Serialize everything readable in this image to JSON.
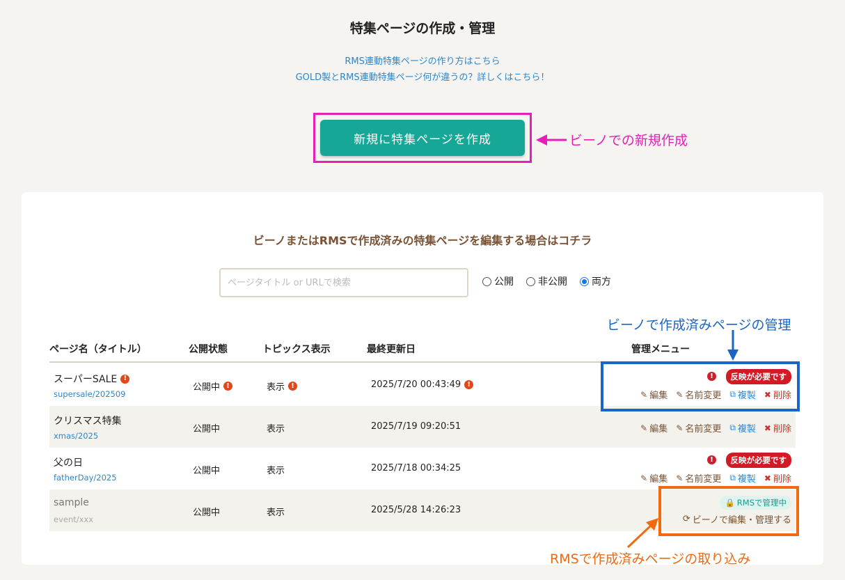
{
  "page": {
    "title": "特集ページの作成・管理",
    "help_link_1": "RMS連動特集ページの作り方はこちら",
    "help_link_2": "GOLD製とRMS連動特集ページ何が違うの？詳しくはこちら！",
    "create_button": "新規に特集ページを作成"
  },
  "annotations": {
    "create": "ビーノでの新規作成",
    "manage": "ビーノで作成済みページの管理",
    "import": "RMSで作成済みページの取り込み",
    "colors": {
      "create": "#e620b7",
      "manage": "#1a66c2",
      "import": "#f06a12"
    }
  },
  "section": {
    "title": "ビーノまたはRMSで作成済みの特集ページを編集する場合はコチラ",
    "search_placeholder": "ページタイトル or URLで検索",
    "filters": [
      {
        "label": "公開",
        "checked": false
      },
      {
        "label": "非公開",
        "checked": false
      },
      {
        "label": "両方",
        "checked": true
      }
    ]
  },
  "table": {
    "headers": {
      "name": "ページ名（タイトル）",
      "status": "公開状態",
      "topic": "トピックス表示",
      "updated": "最終更新日",
      "menu": "管理メニュー"
    },
    "actions": {
      "edit": "編集",
      "rename": "名前変更",
      "copy": "複製",
      "delete": "削除"
    },
    "need_reflect": "反映が必要です",
    "rms_managed": "RMSで管理中",
    "import_label": "ビーノで編集・管理する",
    "rows": [
      {
        "name": "スーパーSALE",
        "slug": "supersale/202509",
        "status": "公開中",
        "topic": "表示",
        "updated": "2025/7/20 00:43:49"
      },
      {
        "name": "クリスマス特集",
        "slug": "xmas/2025",
        "status": "公開中",
        "topic": "表示",
        "updated": "2025/7/19 09:20:51"
      },
      {
        "name": "父の日",
        "slug": "fatherDay/2025",
        "status": "公開中",
        "topic": "表示",
        "updated": "2025/7/18 00:34:25"
      },
      {
        "name": "sample",
        "slug": "event/xxx",
        "status": "公開中",
        "topic": "表示",
        "updated": "2025/5/28 14:26:23"
      }
    ]
  }
}
